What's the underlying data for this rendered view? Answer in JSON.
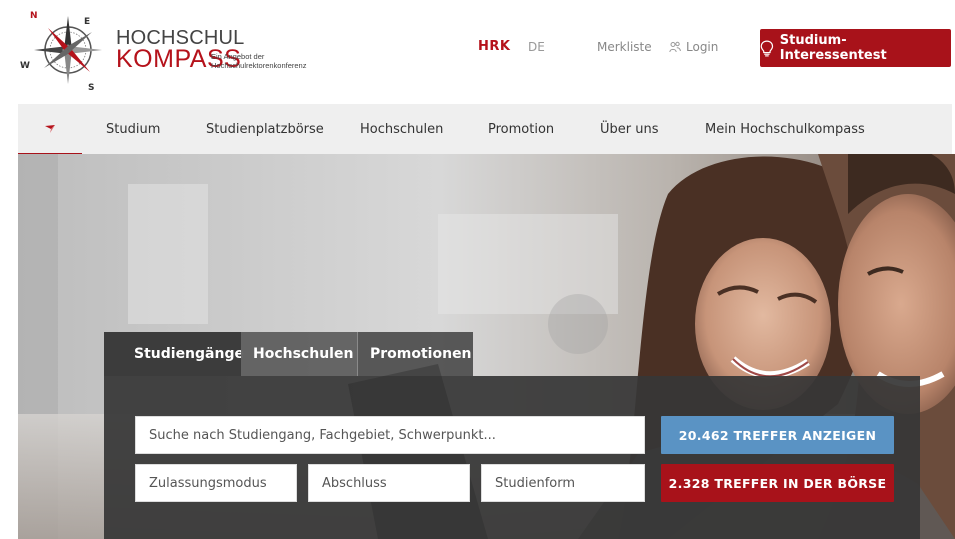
{
  "header": {
    "logo": {
      "word_top": "HOCHSCHUL",
      "word_bottom": "KOMPASS",
      "subtitle_line1": "Ein Angebot der",
      "subtitle_line2": "Hochschulrektorenkonferenz",
      "compass_letters": [
        "N",
        "E",
        "S",
        "W"
      ]
    },
    "hrk_label": "HRK",
    "language_label": "DE",
    "merkliste_label": "Merkliste",
    "login_label": "Login",
    "login_icon": "people-icon",
    "cta_label": "Studium-Interessentest",
    "cta_icon": "lightbulb-icon"
  },
  "nav": {
    "home_icon": "compass-needle-icon",
    "items": [
      "Studium",
      "Studienplatzbörse",
      "Hochschulen",
      "Promotion",
      "Über uns",
      "Mein Hochschulkompass"
    ]
  },
  "search": {
    "tabs": [
      "Studiengänge",
      "Hochschulen",
      "Promotionen"
    ],
    "active_tab": "Studiengänge",
    "query_placeholder": "Suche nach Studiengang, Fachgebiet, Schwerpunkt...",
    "filters": {
      "zulassungsmodus": "Zulassungsmodus",
      "abschluss": "Abschluss",
      "studienform": "Studienform"
    },
    "results_button": "20.462 TREFFER ANZEIGEN",
    "boerse_button": "2.328 TREFFER IN DER BÖRSE"
  },
  "colors": {
    "brand_red": "#a8121a",
    "nav_bg": "#efefef",
    "panel_bg": "#373737",
    "button_blue": "#5a93c4"
  }
}
